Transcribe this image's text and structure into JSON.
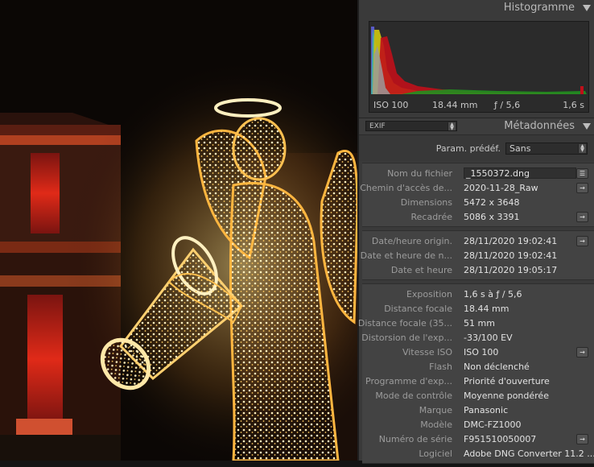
{
  "histogram": {
    "title": "Histogramme",
    "iso": "ISO 100",
    "focal": "18.44 mm",
    "aperture": "ƒ / 5,6",
    "shutter": "1,6 s"
  },
  "metadata": {
    "title": "Métadonnées",
    "view_select": "EXIF",
    "preset_label": "Param. prédéf.",
    "preset_value": "Sans",
    "groups": [
      [
        {
          "label": "Nom du fichier",
          "value": "_1550372.dng",
          "boxed": true,
          "action": "list-icon"
        },
        {
          "label": "Chemin d'accès de...",
          "value": "2020-11-28_Raw",
          "action": "go-arrow-icon"
        },
        {
          "label": "Dimensions",
          "value": "5472 x 3648"
        },
        {
          "label": "Recadrée",
          "value": "5086 x 3391",
          "action": "go-arrow-icon"
        }
      ],
      [
        {
          "label": "Date/heure origin.",
          "value": "28/11/2020 19:02:41",
          "action": "go-arrow-icon"
        },
        {
          "label": "Date et heure de n...",
          "value": "28/11/2020 19:02:41"
        },
        {
          "label": "Date et heure",
          "value": "28/11/2020 19:05:17"
        }
      ],
      [
        {
          "label": "Exposition",
          "value": "1,6 s à ƒ / 5,6"
        },
        {
          "label": "Distance focale",
          "value": "18.44 mm"
        },
        {
          "label": "Distance focale (35...",
          "value": "51 mm"
        },
        {
          "label": "Distorsion de l'exp...",
          "value": "-33/100 EV"
        },
        {
          "label": "Vitesse ISO",
          "value": "ISO 100",
          "action": "go-arrow-icon"
        },
        {
          "label": "Flash",
          "value": "Non déclenché"
        },
        {
          "label": "Programme d'exp...",
          "value": "Priorité d'ouverture"
        },
        {
          "label": "Mode de contrôle",
          "value": "Moyenne pondérée"
        },
        {
          "label": "Marque",
          "value": "Panasonic"
        },
        {
          "label": "Modèle",
          "value": "DMC-FZ1000"
        },
        {
          "label": "Numéro de série",
          "value": "F951510050007",
          "action": "go-arrow-icon"
        },
        {
          "label": "Logiciel",
          "value": "Adobe DNG Converter 11.2 ..."
        }
      ]
    ]
  },
  "icons": {
    "collapse": "triangle-down-icon",
    "list": "☰",
    "go_arrow": "→"
  },
  "colors": {
    "panel_bg": "#3a3a3a",
    "group_bg": "#434343",
    "label": "#9c9c9c",
    "value": "#e2e2e2",
    "histogram_red": "#c0101a",
    "histogram_yellow": "#c8c010",
    "histogram_green": "#209020"
  }
}
